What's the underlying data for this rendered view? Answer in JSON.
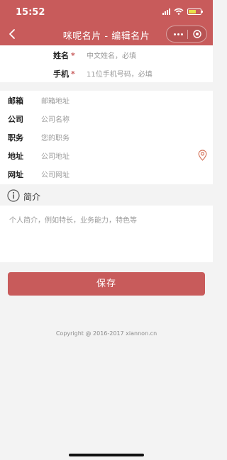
{
  "status": {
    "time": "15:52"
  },
  "nav": {
    "title": "咪呢名片 - 编辑名片"
  },
  "top_fields": [
    {
      "label": "姓名",
      "required_mark": "*",
      "placeholder": "中文姓名，必填"
    },
    {
      "label": "手机",
      "required_mark": "*",
      "placeholder": "11位手机号码，必填"
    }
  ],
  "fields": [
    {
      "label": "邮箱",
      "placeholder": "邮箱地址"
    },
    {
      "label": "公司",
      "placeholder": "公司名称"
    },
    {
      "label": "职务",
      "placeholder": "您的职务"
    },
    {
      "label": "地址",
      "placeholder": "公司地址"
    },
    {
      "label": "网址",
      "placeholder": "公司网址"
    }
  ],
  "intro": {
    "title": "简介",
    "placeholder": "个人简介，例如特长，业务能力，特色等"
  },
  "save_label": "保存",
  "copyright": "Copyright @ 2016-2017 xiannon.cn",
  "colors": {
    "accent": "#c85b5b",
    "background": "#f3f3f3"
  },
  "icons": [
    "back-arrow-icon",
    "more-dots-icon",
    "target-icon",
    "location-pin-icon",
    "info-icon"
  ]
}
